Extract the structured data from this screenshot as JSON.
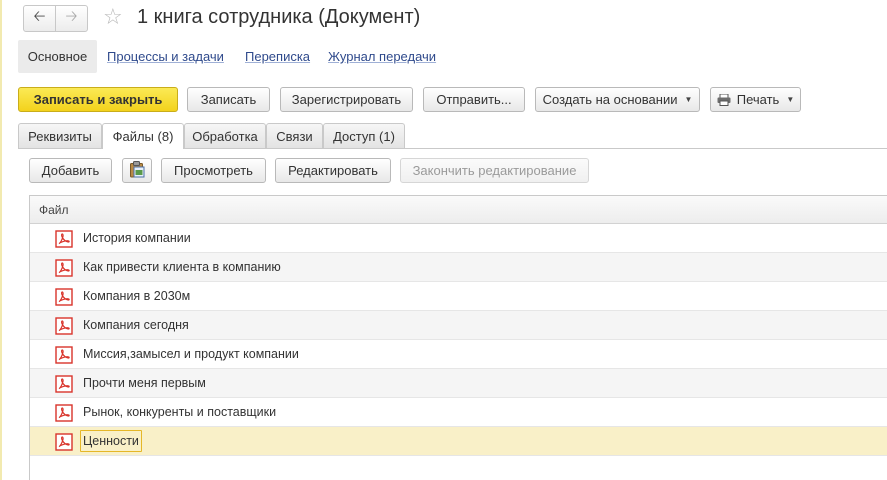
{
  "window": {
    "title": "1 книга сотрудника (Документ)",
    "back_icon": "arrow-left",
    "forward_icon": "arrow-right",
    "favorite_icon": "star"
  },
  "sections": {
    "active": "Основное",
    "links": [
      "Процессы и задачи",
      "Переписка",
      "Журнал передачи"
    ]
  },
  "toolbar": {
    "save_close": "Записать и закрыть",
    "save": "Записать",
    "register": "Зарегистрировать",
    "send": "Отправить...",
    "create_based": "Создать на основании",
    "print": "Печать"
  },
  "tabs": [
    "Реквизиты",
    "Файлы (8)",
    "Обработка",
    "Связи",
    "Доступ (1)"
  ],
  "files_toolbar": {
    "add": "Добавить",
    "view": "Просмотреть",
    "edit": "Редактировать",
    "finish_edit": "Закончить редактирование"
  },
  "table": {
    "header": "Файл",
    "rows": [
      "История компании",
      "Как привести клиента в компанию",
      "Компания в 2030м",
      "Компания сегодня",
      "Миссия,замысел и продукт компании",
      "Прочти меня первым",
      "Рынок, конкуренты и поставщики",
      "Ценности"
    ],
    "selected_index": 7
  },
  "colors": {
    "primary_button": "#f3d21c",
    "link": "#2f4a8c",
    "pdf_icon": "#d9342b",
    "selected_row": "#f9f0c8"
  }
}
